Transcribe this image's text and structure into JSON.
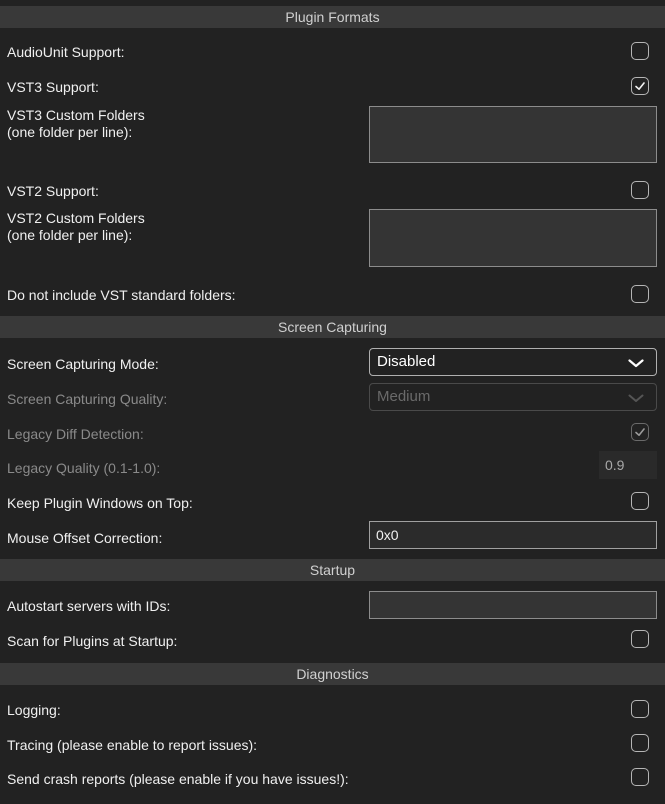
{
  "sections": {
    "plugin_formats": "Plugin Formats",
    "screen_capturing": "Screen Capturing",
    "startup": "Startup",
    "diagnostics": "Diagnostics"
  },
  "plugin_formats": {
    "audiounit_label": "AudioUnit Support:",
    "audiounit_checked": false,
    "vst3_label": "VST3 Support:",
    "vst3_checked": true,
    "vst3_folders_label_1": "VST3 Custom Folders",
    "vst3_folders_label_2": "(one folder per line):",
    "vst3_folders_value": "",
    "vst2_label": "VST2 Support:",
    "vst2_checked": false,
    "vst2_folders_label_1": "VST2 Custom Folders",
    "vst2_folders_label_2": "(one folder per line):",
    "vst2_folders_value": "",
    "no_std_folders_label": "Do not include VST standard folders:",
    "no_std_folders_checked": false
  },
  "screen_capturing": {
    "mode_label": "Screen Capturing Mode:",
    "mode_value": "Disabled",
    "quality_label": "Screen Capturing Quality:",
    "quality_value": "Medium",
    "legacy_diff_label": "Legacy Diff Detection:",
    "legacy_diff_checked": true,
    "legacy_quality_label": "Legacy Quality (0.1-1.0):",
    "legacy_quality_value": "0.9",
    "keep_on_top_label": "Keep Plugin Windows on Top:",
    "keep_on_top_checked": false,
    "mouse_offset_label": "Mouse Offset Correction:",
    "mouse_offset_value": "0x0"
  },
  "startup": {
    "autostart_label": "Autostart servers with IDs:",
    "autostart_value": "",
    "scan_label": "Scan for Plugins at Startup:",
    "scan_checked": false
  },
  "diagnostics": {
    "logging_label": "Logging:",
    "logging_checked": false,
    "tracing_label": "Tracing (please enable to report issues):",
    "tracing_checked": false,
    "crash_label": "Send crash reports (please enable if you have issues!):",
    "crash_checked": false
  },
  "icons": {
    "check": "checkmark-icon",
    "chevron": "chevron-down-icon"
  },
  "colors": {
    "background": "#222222",
    "header": "#393939",
    "field": "#343434"
  }
}
